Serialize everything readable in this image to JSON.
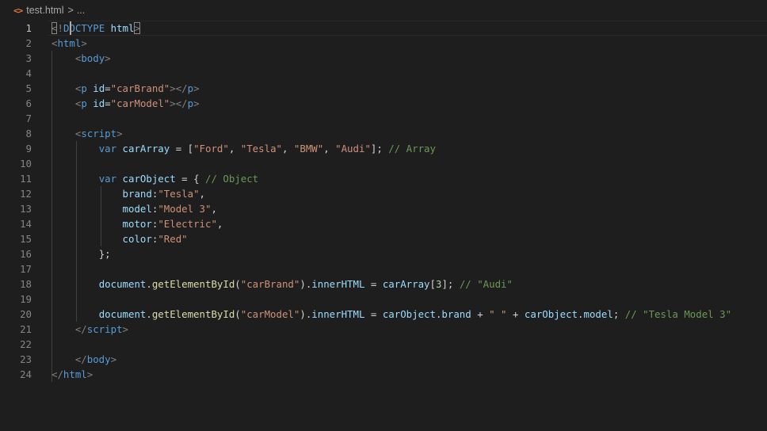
{
  "breadcrumb": {
    "icon": "html-file-icon",
    "file": "test.html",
    "separator": ">",
    "more": "..."
  },
  "editor": {
    "active_line": 1,
    "line_numbers": [
      "1",
      "2",
      "3",
      "4",
      "5",
      "6",
      "7",
      "8",
      "9",
      "10",
      "11",
      "12",
      "13",
      "14",
      "15",
      "16",
      "17",
      "18",
      "19",
      "20",
      "21",
      "22",
      "23",
      "24"
    ],
    "lines": [
      [
        [
          "<",
          "t"
        ],
        [
          "!",
          "t"
        ],
        [
          "DOCTYPE",
          "tg"
        ],
        [
          " ",
          "df"
        ],
        [
          "html",
          "at"
        ],
        [
          ">",
          "t"
        ]
      ],
      [
        [
          "<",
          "t"
        ],
        [
          "html",
          "tg"
        ],
        [
          ">",
          "t"
        ]
      ],
      [
        [
          "    ",
          "df"
        ],
        [
          "<",
          "t"
        ],
        [
          "body",
          "tg"
        ],
        [
          ">",
          "t"
        ]
      ],
      [],
      [
        [
          "    ",
          "df"
        ],
        [
          "<",
          "t"
        ],
        [
          "p",
          "tg"
        ],
        [
          " ",
          "df"
        ],
        [
          "id",
          "at"
        ],
        [
          "=",
          "df"
        ],
        [
          "\"carBrand\"",
          "st"
        ],
        [
          "></",
          "t"
        ],
        [
          "p",
          "tg"
        ],
        [
          ">",
          "t"
        ]
      ],
      [
        [
          "    ",
          "df"
        ],
        [
          "<",
          "t"
        ],
        [
          "p",
          "tg"
        ],
        [
          " ",
          "df"
        ],
        [
          "id",
          "at"
        ],
        [
          "=",
          "df"
        ],
        [
          "\"carModel\"",
          "st"
        ],
        [
          "></",
          "t"
        ],
        [
          "p",
          "tg"
        ],
        [
          ">",
          "t"
        ]
      ],
      [],
      [
        [
          "    ",
          "df"
        ],
        [
          "<",
          "t"
        ],
        [
          "script",
          "tg"
        ],
        [
          ">",
          "t"
        ]
      ],
      [
        [
          "        ",
          "df"
        ],
        [
          "var",
          "kw"
        ],
        [
          " ",
          "df"
        ],
        [
          "carArray",
          "vr"
        ],
        [
          " = [",
          "df"
        ],
        [
          "\"Ford\"",
          "st"
        ],
        [
          ", ",
          "df"
        ],
        [
          "\"Tesla\"",
          "st"
        ],
        [
          ", ",
          "df"
        ],
        [
          "\"BMW\"",
          "st"
        ],
        [
          ", ",
          "df"
        ],
        [
          "\"Audi\"",
          "st"
        ],
        [
          "]; ",
          "df"
        ],
        [
          "// Array",
          "cm"
        ]
      ],
      [],
      [
        [
          "        ",
          "df"
        ],
        [
          "var",
          "kw"
        ],
        [
          " ",
          "df"
        ],
        [
          "carObject",
          "vr"
        ],
        [
          " = { ",
          "df"
        ],
        [
          "// Object",
          "cm"
        ]
      ],
      [
        [
          "            ",
          "df"
        ],
        [
          "brand",
          "at"
        ],
        [
          ":",
          "df"
        ],
        [
          "\"Tesla\"",
          "st"
        ],
        [
          ",",
          "df"
        ]
      ],
      [
        [
          "            ",
          "df"
        ],
        [
          "model",
          "at"
        ],
        [
          ":",
          "df"
        ],
        [
          "\"Model 3\"",
          "st"
        ],
        [
          ",",
          "df"
        ]
      ],
      [
        [
          "            ",
          "df"
        ],
        [
          "motor",
          "at"
        ],
        [
          ":",
          "df"
        ],
        [
          "\"Electric\"",
          "st"
        ],
        [
          ",",
          "df"
        ]
      ],
      [
        [
          "            ",
          "df"
        ],
        [
          "color",
          "at"
        ],
        [
          ":",
          "df"
        ],
        [
          "\"Red\"",
          "st"
        ]
      ],
      [
        [
          "        ",
          "df"
        ],
        [
          "};",
          "df"
        ]
      ],
      [],
      [
        [
          "        ",
          "df"
        ],
        [
          "document",
          "vr"
        ],
        [
          ".",
          "df"
        ],
        [
          "getElementById",
          "fn"
        ],
        [
          "(",
          "df"
        ],
        [
          "\"carBrand\"",
          "st"
        ],
        [
          ").",
          "df"
        ],
        [
          "innerHTML",
          "vr"
        ],
        [
          " = ",
          "df"
        ],
        [
          "carArray",
          "vr"
        ],
        [
          "[",
          "df"
        ],
        [
          "3",
          "nm"
        ],
        [
          "]; ",
          "df"
        ],
        [
          "// \"Audi\"",
          "cm"
        ]
      ],
      [],
      [
        [
          "        ",
          "df"
        ],
        [
          "document",
          "vr"
        ],
        [
          ".",
          "df"
        ],
        [
          "getElementById",
          "fn"
        ],
        [
          "(",
          "df"
        ],
        [
          "\"carModel\"",
          "st"
        ],
        [
          ").",
          "df"
        ],
        [
          "innerHTML",
          "vr"
        ],
        [
          " = ",
          "df"
        ],
        [
          "carObject",
          "vr"
        ],
        [
          ".",
          "df"
        ],
        [
          "brand",
          "vr"
        ],
        [
          " + ",
          "df"
        ],
        [
          "\" \"",
          "st"
        ],
        [
          " + ",
          "df"
        ],
        [
          "carObject",
          "vr"
        ],
        [
          ".",
          "df"
        ],
        [
          "model",
          "vr"
        ],
        [
          "; ",
          "df"
        ],
        [
          "// \"Tesla Model 3\"",
          "cm"
        ]
      ],
      [
        [
          "    ",
          "df"
        ],
        [
          "</",
          "t"
        ],
        [
          "script",
          "tg"
        ],
        [
          ">",
          "t"
        ]
      ],
      [],
      [
        [
          "    ",
          "df"
        ],
        [
          "</",
          "t"
        ],
        [
          "body",
          "tg"
        ],
        [
          ">",
          "t"
        ]
      ],
      [
        [
          "</",
          "t"
        ],
        [
          "html",
          "tg"
        ],
        [
          ">",
          "t"
        ]
      ]
    ]
  }
}
